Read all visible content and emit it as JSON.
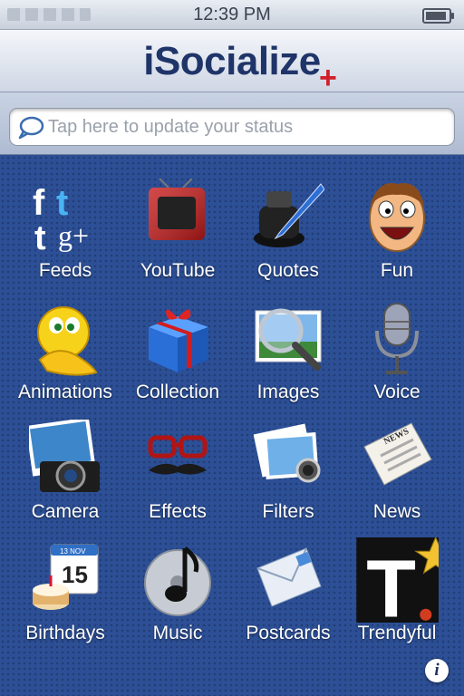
{
  "status_bar": {
    "time": "12:39 PM"
  },
  "header": {
    "title": "iSocialize",
    "plus": "+"
  },
  "status_update": {
    "placeholder": "Tap here to update your status"
  },
  "tiles": [
    {
      "label": "Feeds",
      "icon": "feeds-icon"
    },
    {
      "label": "YouTube",
      "icon": "youtube-tv-icon"
    },
    {
      "label": "Quotes",
      "icon": "quill-ink-icon"
    },
    {
      "label": "Fun",
      "icon": "laughing-face-icon"
    },
    {
      "label": "Animations",
      "icon": "emoji-thinking-icon"
    },
    {
      "label": "Collection",
      "icon": "gift-box-icon"
    },
    {
      "label": "Images",
      "icon": "magnifier-photo-icon"
    },
    {
      "label": "Voice",
      "icon": "microphone-icon"
    },
    {
      "label": "Camera",
      "icon": "camera-icon"
    },
    {
      "label": "Effects",
      "icon": "glasses-mustache-icon"
    },
    {
      "label": "Filters",
      "icon": "photo-filter-icon"
    },
    {
      "label": "News",
      "icon": "newspaper-icon"
    },
    {
      "label": "Birthdays",
      "icon": "calendar-cake-icon"
    },
    {
      "label": "Music",
      "icon": "music-note-icon"
    },
    {
      "label": "Postcards",
      "icon": "envelope-icon"
    },
    {
      "label": "Trendyful",
      "icon": "trendyful-logo-icon"
    }
  ],
  "feeds_icon": {
    "f": "f",
    "t": "t",
    "g": "g+"
  },
  "calendar_icon": {
    "day": "15",
    "month": "13 NOV"
  },
  "news_icon": {
    "masthead": "NEWS"
  },
  "trendyful_icon": {
    "letter": "T"
  },
  "info_button": {
    "glyph": "i"
  },
  "colors": {
    "brand_navy": "#1f3468",
    "plus_red": "#d11e2a",
    "grid_blue": "#2c4f96"
  }
}
